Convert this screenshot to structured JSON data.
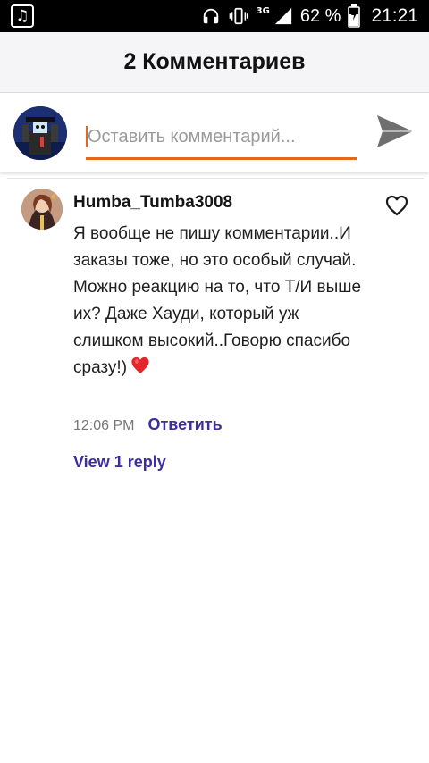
{
  "status_bar": {
    "notification_icon": "music-note-icon",
    "network": "3G",
    "battery_percent": "62 %",
    "time": "21:21",
    "icons": [
      "headphones-icon",
      "vibrate-icon",
      "signal-icon",
      "battery-charging-icon"
    ]
  },
  "header": {
    "title": "2 Комментариев"
  },
  "compose": {
    "placeholder": "Оставить комментарий...",
    "value": "",
    "accent_color": "#e8651d",
    "send_icon": "send-icon"
  },
  "comments": [
    {
      "author": "Humba_Tumba3008",
      "text": "Я вообще не пишу комментарии..И заказы тоже, но это особый случай.\nМожно реакцию на то, что Т/И выше их? Даже Хауди, который уж слишком высокий..Говорю спасибо сразу!)",
      "emoji_icon": "red-heart-icon",
      "time": "12:06 PM",
      "reply_label": "Ответить",
      "view_replies_label": "View 1 reply",
      "like_icon": "heart-outline-icon"
    }
  ],
  "colors": {
    "link": "#3b2ea3",
    "header_bg": "#f5f5f7",
    "status_bar_bg": "#000000"
  }
}
